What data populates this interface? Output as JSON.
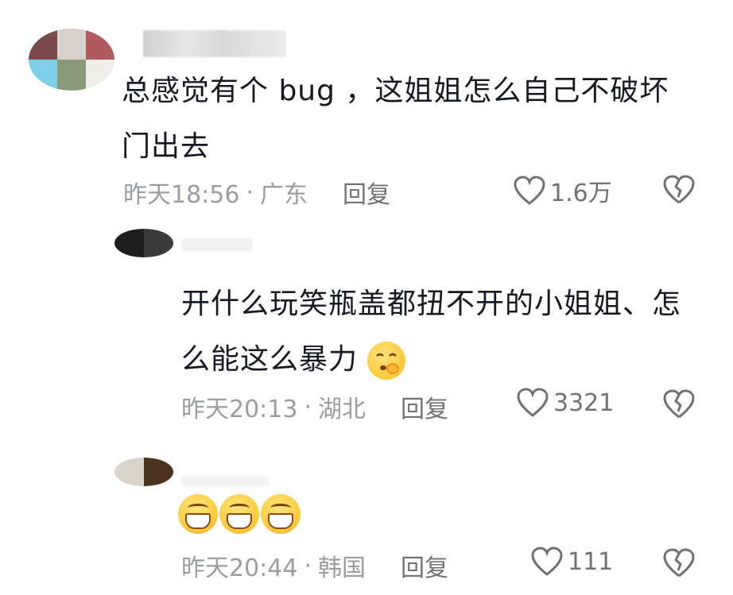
{
  "comments": [
    {
      "text_line1": "总感觉有个 bug ，这姐姐怎么自己不破坏",
      "text_line2": "门出去",
      "time": "昨天18:56",
      "location": "广东",
      "reply_label": "回复",
      "likes": "1.6万"
    },
    {
      "text_line1": "开什么玩笑瓶盖都扭不开的小姐姐、怎",
      "text_line2": "么能这么暴力",
      "emoji": "shushing-face-emoji",
      "time": "昨天20:13",
      "location": "湖北",
      "reply_label": "回复",
      "likes": "3321"
    },
    {
      "emojis": [
        "grinning-face-emoji",
        "grinning-face-emoji",
        "grinning-face-emoji"
      ],
      "time": "昨天20:44",
      "location": "韩国",
      "reply_label": "回复",
      "likes": "111"
    }
  ],
  "separator": "·",
  "colors": {
    "text": "#161823",
    "meta": "#9a9ca3",
    "action": "#6f7178"
  }
}
